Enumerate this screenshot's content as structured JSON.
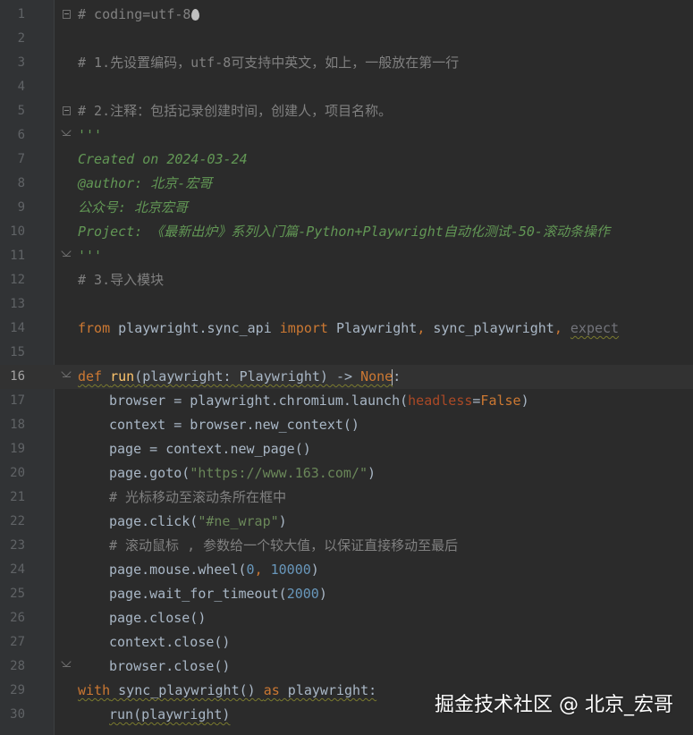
{
  "editor": {
    "current_line": 16,
    "lines": [
      {
        "n": "1",
        "tokens": [
          {
            "t": "# coding=utf-8",
            "c": "c-comment"
          }
        ]
      },
      {
        "n": "2",
        "tokens": []
      },
      {
        "n": "3",
        "tokens": [
          {
            "t": "# 1.先设置编码，utf-8可支持中英文，如上，一般放在第一行",
            "c": "c-comment"
          }
        ]
      },
      {
        "n": "4",
        "tokens": []
      },
      {
        "n": "5",
        "tokens": [
          {
            "t": "# 2.注释：包括记录创建时间，创建人，项目名称。",
            "c": "c-comment"
          }
        ]
      },
      {
        "n": "6",
        "tokens": [
          {
            "t": "'''",
            "c": "c-doc"
          }
        ]
      },
      {
        "n": "7",
        "tokens": [
          {
            "t": "Created on 2024-03-24",
            "c": "c-doc"
          }
        ]
      },
      {
        "n": "8",
        "tokens": [
          {
            "t": "@author: 北京-宏哥",
            "c": "c-doc"
          }
        ]
      },
      {
        "n": "9",
        "tokens": [
          {
            "t": "公众号: 北京宏哥",
            "c": "c-doc"
          }
        ]
      },
      {
        "n": "10",
        "tokens": [
          {
            "t": "Project: 《最新出炉》系列入门篇-Python+Playwright自动化测试-50-滚动条操作",
            "c": "c-doc"
          }
        ]
      },
      {
        "n": "11",
        "tokens": [
          {
            "t": "'''",
            "c": "c-doc"
          }
        ]
      },
      {
        "n": "12",
        "tokens": [
          {
            "t": "# 3.导入模块",
            "c": "c-comment"
          }
        ]
      },
      {
        "n": "13",
        "tokens": []
      },
      {
        "n": "14",
        "tokens": [
          {
            "t": "from",
            "c": "c-kw"
          },
          {
            "t": " playwright.sync_api ",
            "c": ""
          },
          {
            "t": "import",
            "c": "c-kw"
          },
          {
            "t": " Playwright",
            "c": ""
          },
          {
            "t": ",",
            "c": "c-kw"
          },
          {
            "t": " sync_playwright",
            "c": ""
          },
          {
            "t": ",",
            "c": "c-kw"
          },
          {
            "t": " ",
            "c": ""
          },
          {
            "t": "expect",
            "c": "c-dim wavy"
          }
        ]
      },
      {
        "n": "15",
        "tokens": []
      },
      {
        "n": "16",
        "tokens": [
          {
            "t": "def",
            "c": "c-kw wavy"
          },
          {
            "t": " ",
            "c": "wavy"
          },
          {
            "t": "run",
            "c": "c-fn wavy"
          },
          {
            "t": "(playwright: Playwright) -> ",
            "c": "wavy"
          },
          {
            "t": "None",
            "c": "c-kw wavy"
          },
          {
            "t": "|",
            "c": "caret"
          },
          {
            "t": ":",
            "c": ""
          }
        ]
      },
      {
        "n": "17",
        "indent": true,
        "tokens": [
          {
            "t": "browser = playwright.chromium.launch(",
            "c": ""
          },
          {
            "t": "headless",
            "c": "c-param"
          },
          {
            "t": "=",
            "c": ""
          },
          {
            "t": "False",
            "c": "c-kw"
          },
          {
            "t": ")",
            "c": ""
          }
        ]
      },
      {
        "n": "18",
        "indent": true,
        "tokens": [
          {
            "t": "context = browser.new_context()",
            "c": ""
          }
        ]
      },
      {
        "n": "19",
        "indent": true,
        "tokens": [
          {
            "t": "page = context.new_page()",
            "c": ""
          }
        ]
      },
      {
        "n": "20",
        "indent": true,
        "tokens": [
          {
            "t": "page.goto(",
            "c": ""
          },
          {
            "t": "\"https://www.163.com/\"",
            "c": "c-str"
          },
          {
            "t": ")",
            "c": ""
          }
        ]
      },
      {
        "n": "21",
        "indent": true,
        "tokens": [
          {
            "t": "# 光标移动至滚动条所在框中",
            "c": "c-comment"
          }
        ]
      },
      {
        "n": "22",
        "indent": true,
        "tokens": [
          {
            "t": "page.click(",
            "c": ""
          },
          {
            "t": "\"#ne_wrap\"",
            "c": "c-str"
          },
          {
            "t": ")",
            "c": ""
          }
        ]
      },
      {
        "n": "23",
        "indent": true,
        "tokens": [
          {
            "t": "# 滚动鼠标 , 参数给一个较大值，以保证直接移动至最后",
            "c": "c-comment"
          }
        ]
      },
      {
        "n": "24",
        "indent": true,
        "tokens": [
          {
            "t": "page.mouse.wheel(",
            "c": ""
          },
          {
            "t": "0",
            "c": "c-num"
          },
          {
            "t": ",",
            "c": "c-kw"
          },
          {
            "t": " ",
            "c": ""
          },
          {
            "t": "10000",
            "c": "c-num"
          },
          {
            "t": ")",
            "c": ""
          }
        ]
      },
      {
        "n": "25",
        "indent": true,
        "tokens": [
          {
            "t": "page.wait_for_timeout(",
            "c": ""
          },
          {
            "t": "2000",
            "c": "c-num"
          },
          {
            "t": ")",
            "c": ""
          }
        ]
      },
      {
        "n": "26",
        "indent": true,
        "tokens": [
          {
            "t": "page.close()",
            "c": ""
          }
        ]
      },
      {
        "n": "27",
        "indent": true,
        "tokens": [
          {
            "t": "context.close()",
            "c": ""
          }
        ]
      },
      {
        "n": "28",
        "indent": true,
        "tokens": [
          {
            "t": "browser.close()",
            "c": ""
          }
        ]
      },
      {
        "n": "29",
        "tokens": [
          {
            "t": "with",
            "c": "c-kw wavy"
          },
          {
            "t": " sync_playwright() ",
            "c": "wavy"
          },
          {
            "t": "as",
            "c": "c-kw wavy"
          },
          {
            "t": " playwright:",
            "c": "wavy"
          }
        ]
      },
      {
        "n": "30",
        "indent": true,
        "tokens": [
          {
            "t": "run(playwright)",
            "c": "wavy"
          }
        ]
      }
    ],
    "folds": [
      {
        "line": 1,
        "kind": "start"
      },
      {
        "line": 5,
        "kind": "start"
      },
      {
        "line": 6,
        "kind": "end"
      },
      {
        "line": 11,
        "kind": "end"
      },
      {
        "line": 16,
        "kind": "end"
      },
      {
        "line": 28,
        "kind": "end"
      }
    ]
  },
  "watermark": {
    "text": "掘金技术社区 @ 北京_宏哥"
  },
  "icons": {
    "line1_trailing": "flame-icon"
  }
}
